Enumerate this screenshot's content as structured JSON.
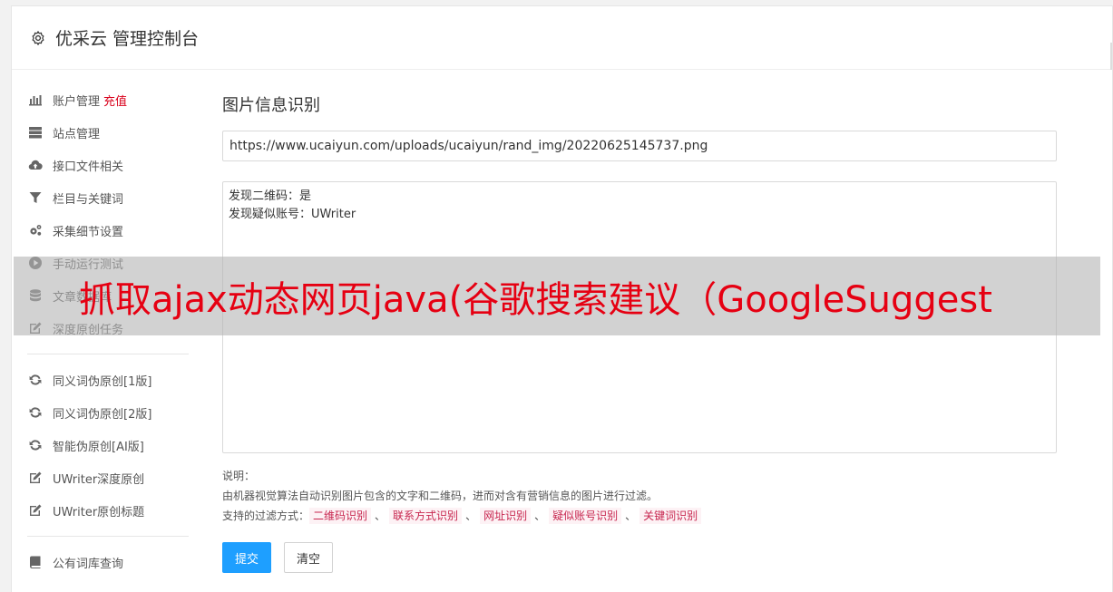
{
  "header": {
    "title": "优采云 管理控制台",
    "icon": "gear-icon"
  },
  "sidebar": {
    "group1": [
      {
        "label": "账户管理",
        "badge": "充值",
        "icon": "bar-chart-icon"
      },
      {
        "label": "站点管理",
        "icon": "server-icon"
      },
      {
        "label": "接口文件相关",
        "icon": "cloud-upload-icon"
      },
      {
        "label": "栏目与关键词",
        "icon": "filter-icon"
      },
      {
        "label": "采集细节设置",
        "icon": "cogs-icon"
      },
      {
        "label": "手动运行测试",
        "icon": "play-circle-icon"
      },
      {
        "label": "文章数据库",
        "icon": "database-icon"
      },
      {
        "label": "深度原创任务",
        "icon": "edit-icon"
      }
    ],
    "group2": [
      {
        "label": "同义词伪原创[1版]",
        "icon": "refresh-icon"
      },
      {
        "label": "同义词伪原创[2版]",
        "icon": "refresh-icon"
      },
      {
        "label": "智能伪原创[AI版]",
        "icon": "refresh-icon"
      },
      {
        "label": "UWriter深度原创",
        "icon": "edit-icon"
      },
      {
        "label": "UWriter原创标题",
        "icon": "edit-icon"
      }
    ],
    "group3": [
      {
        "label": "公有词库查询",
        "icon": "book-icon"
      }
    ]
  },
  "main": {
    "title": "图片信息识别",
    "url_value": "https://www.ucaiyun.com/uploads/ucaiyun/rand_img/20220625145737.png",
    "result_text": "发现二维码：是\n发现疑似账号：UWriter",
    "desc_label": "说明：",
    "desc_text": "由机器视觉算法自动识别图片包含的文字和二维码，进而对含有营销信息的图片进行过滤。",
    "filter_label": "支持的过滤方式：",
    "filters": [
      "二维码识别",
      "联系方式识别",
      "网址识别",
      "疑似账号识别",
      "关键词识别"
    ],
    "separator": "、",
    "submit_label": "提交",
    "clear_label": "清空"
  },
  "overlay": {
    "text": "抓取ajax动态网页java(谷歌搜索建议（GoogleSuggest"
  },
  "colors": {
    "accent": "#1e9fff",
    "recharge": "#d9001b",
    "tag_text": "#c7254e",
    "overlay_text": "#e60012"
  }
}
